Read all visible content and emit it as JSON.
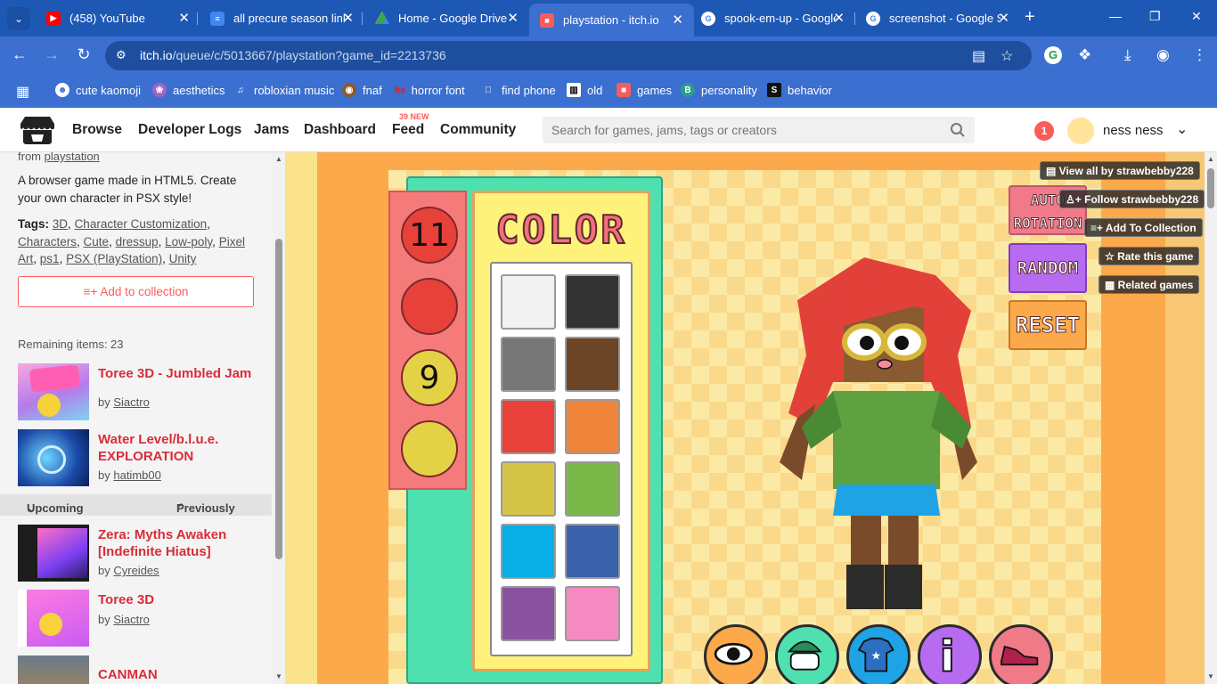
{
  "browser": {
    "tabs": [
      {
        "title": "(458) YouTube",
        "icon": "youtube-icon",
        "color": "#ff0000"
      },
      {
        "title": "all precure season link",
        "icon": "docs-icon",
        "color": "#4285f4"
      },
      {
        "title": "Home - Google Drive",
        "icon": "drive-icon",
        "color": "#34a853"
      },
      {
        "title": "playstation - itch.io",
        "icon": "itch-icon",
        "color": "#fa5c5c"
      },
      {
        "title": "spook-em-up - Google",
        "icon": "google-icon",
        "color": "#ffffff"
      },
      {
        "title": "screenshot - Google S",
        "icon": "google-icon",
        "color": "#ffffff"
      }
    ],
    "url_main": "itch.io",
    "url_rest": "/queue/c/5013667/playstation?game_id=2213736",
    "bookmarks": [
      "cute kaomoji",
      "aesthetics",
      "robloxian music",
      "fnaf",
      "horror font",
      "find phone",
      "old",
      "games",
      "personality",
      "behavior"
    ],
    "bookmark_badge_ba": "ba",
    "bookmark_badge_b": "B",
    "bookmark_badge_s": "S"
  },
  "itch": {
    "nav": [
      "Browse",
      "Developer Logs",
      "Jams",
      "Dashboard",
      "Feed",
      "Community"
    ],
    "feed_badge": "39 NEW",
    "search_placeholder": "Search for games, jams, tags or creators",
    "notifications": "1",
    "username": "ness ness"
  },
  "sidebar": {
    "from_prefix": "from",
    "from_link": "playstation",
    "description": "A browser game made in HTML5. Create your own character in PSX style!",
    "tags_label": "Tags:",
    "tags": [
      "3D",
      "Character Customization",
      "Characters",
      "Cute",
      "dressup",
      "Low-poly",
      "Pixel Art",
      "ps1",
      "PSX (PlayStation)",
      "Unity"
    ],
    "add_collection": "Add to collection",
    "remaining": "Remaining items: 23",
    "upcoming": "Upcoming",
    "previously": "Previously",
    "by_prefix": "by",
    "games": [
      {
        "title": "Toree 3D - Jumbled Jam",
        "author": "Siactro"
      },
      {
        "title": "Water Level/b.l.u.e. EXPLORATION",
        "author": "hatimb00"
      },
      {
        "title": "Zera: Myths Awaken [Indefinite Hiatus]",
        "author": "Cyreides"
      },
      {
        "title": "Toree 3D",
        "author": "Siactro"
      },
      {
        "title": "CANMAN",
        "author": ""
      }
    ]
  },
  "game": {
    "color_title": "COLOR",
    "circles": [
      {
        "label": "11",
        "color": "#e8413a"
      },
      {
        "label": "",
        "color": "#e8413a"
      },
      {
        "label": "9",
        "color": "#e3d246"
      },
      {
        "label": "",
        "color": "#e3d246"
      }
    ],
    "swatches": [
      "#f2f2f2",
      "#333333",
      "#777777",
      "#6b4526",
      "#e8413a",
      "#ef843a",
      "#d4c448",
      "#7ab84a",
      "#0aaee6",
      "#3a62ad",
      "#8a53a0",
      "#f48ac0"
    ],
    "btn_auto": "AUTO ROTATION",
    "btn_random": "RANDOM",
    "btn_reset": "RESET",
    "itch_chips": [
      "View all by strawbebby228",
      "Follow strawbebby228",
      "Add To Collection",
      "Rate this game",
      "Related games"
    ],
    "bottom_buttons": [
      "eye-icon",
      "mask-icon",
      "shirt-icon",
      "info-icon",
      "shoe-icon"
    ]
  }
}
